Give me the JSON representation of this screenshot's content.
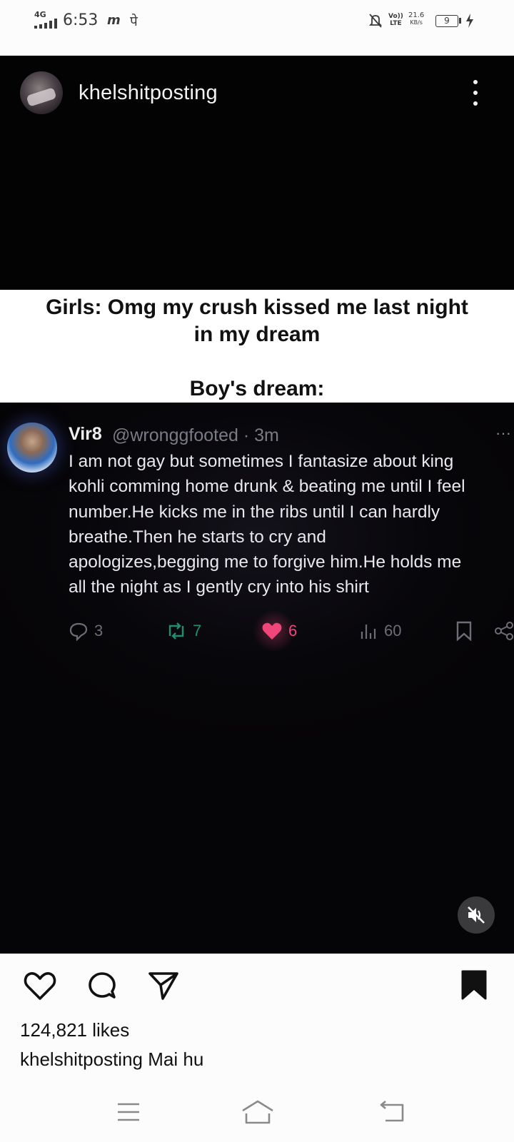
{
  "status_bar": {
    "network": "4G",
    "time": "6:53",
    "speed_value": "21.6",
    "speed_unit": "KB/s",
    "battery": "9",
    "volte_top": "Vo))",
    "volte_bottom": "LTE",
    "notif_icon_1": "m",
    "notif_icon_2": "पे"
  },
  "post": {
    "username": "khelshitposting",
    "meme_caption_line1": "Girls: Omg my crush kissed me last night",
    "meme_caption_line2": "in my dream",
    "meme_caption_line3": "Boy's dream:",
    "tweet": {
      "name": "Vir8",
      "handle_time": "@wronggfooted · 3m",
      "more": "···",
      "lines": [
        "I am not gay but sometimes I fantasize about king",
        "kohli comming home drunk & beating me until I feel",
        "number.He kicks me in the ribs until I can hardly",
        "breathe.Then he starts to cry and",
        "apologizes,begging me to forgive him.He holds me",
        "all the night as I gently cry into his shirt"
      ],
      "replies": "3",
      "retweets": "7",
      "likes": "6",
      "views": "60",
      "colors": {
        "retweet": "#1f8f6a",
        "like": "#f0467a",
        "muted": "#6d6d78"
      }
    },
    "likes_text": "124,821 likes",
    "caption_user": "khelshitposting",
    "caption_text": "Mai hu"
  }
}
